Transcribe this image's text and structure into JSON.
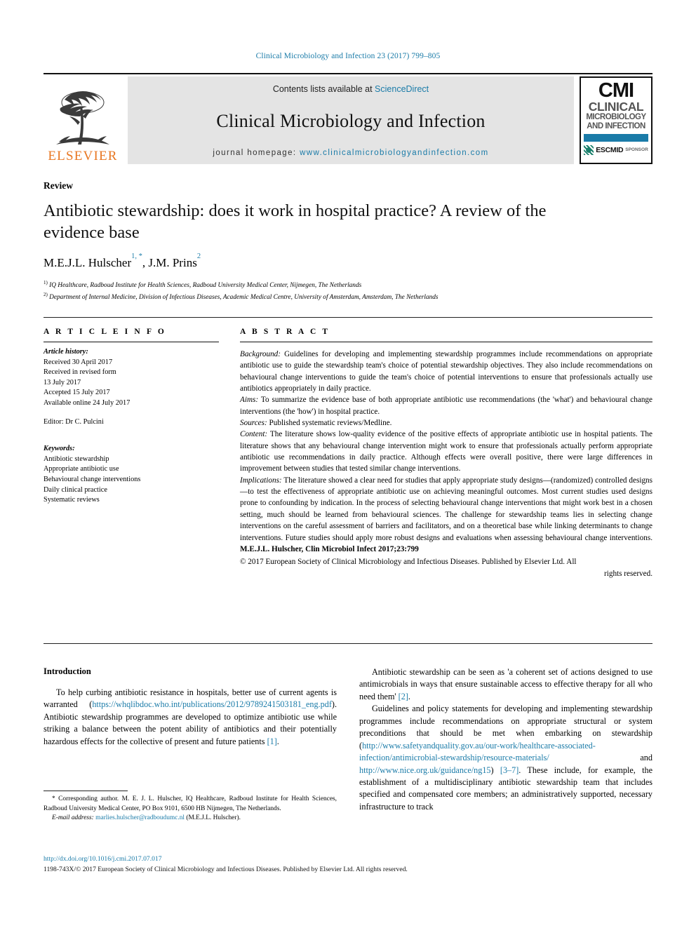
{
  "running_head": "Clinical Microbiology and Infection 23 (2017) 799–805",
  "masthead": {
    "publisher_logo_word": "ELSEVIER",
    "contents_prefix": "Contents lists available at ",
    "contents_link": "ScienceDirect",
    "journal_title": "Clinical Microbiology and Infection",
    "homepage_label": "journal homepage: ",
    "homepage_url": "www.clinicalmicrobiologyandinfection.com",
    "cmi": {
      "abbr": "CMI",
      "line1": "CLINICAL",
      "line2": "MICROBIOLOGY",
      "line3": "AND INFECTION",
      "society": "ESCMID",
      "society_sub": "SPONSOR",
      "bar_color": "#1a7ba8"
    }
  },
  "article": {
    "kind": "Review",
    "title": "Antibiotic stewardship: does it work in hospital practice? A review of the evidence base",
    "authors_plain": "M.E.J.L. Hulscher",
    "authors": [
      {
        "name": "M.E.J.L. Hulscher",
        "marks": "1, *"
      },
      {
        "name": "J.M. Prins",
        "marks": "2"
      }
    ],
    "affiliations": [
      {
        "mark": "1)",
        "text": "IQ Healthcare, Radboud Institute for Health Sciences, Radboud University Medical Center, Nijmegen, The Netherlands"
      },
      {
        "mark": "2)",
        "text": "Department of Internal Medicine, Division of Infectious Diseases, Academic Medical Centre, University of Amsterdam, Amsterdam, The Netherlands"
      }
    ]
  },
  "article_info": {
    "heading": "A R T I C L E  I N F O",
    "history_label": "Article history:",
    "history": [
      "Received 30 April 2017",
      "Received in revised form",
      "13 July 2017",
      "Accepted 15 July 2017",
      "Available online 24 July 2017"
    ],
    "editor": "Editor: Dr C. Pulcini",
    "keywords_label": "Keywords:",
    "keywords": [
      "Antibiotic stewardship",
      "Appropriate antibiotic use",
      "Behavioural change interventions",
      "Daily clinical practice",
      "Systematic reviews"
    ]
  },
  "abstract": {
    "heading": "A B S T R A C T",
    "sections": [
      {
        "label": "Background:",
        "text": " Guidelines for developing and implementing stewardship programmes include recommendations on appropriate antibiotic use to guide the stewardship team's choice of potential stewardship objectives. They also include recommendations on behavioural change interventions to guide the team's choice of potential interventions to ensure that professionals actually use antibiotics appropriately in daily practice."
      },
      {
        "label": "Aims:",
        "text": " To summarize the evidence base of both appropriate antibiotic use recommendations (the 'what') and behavioural change interventions (the 'how') in hospital practice."
      },
      {
        "label": "Sources:",
        "text": " Published systematic reviews/Medline."
      },
      {
        "label": "Content:",
        "text": " The literature shows low-quality evidence of the positive effects of appropriate antibiotic use in hospital patients. The literature shows that any behavioural change intervention might work to ensure that professionals actually perform appropriate antibiotic use recommendations in daily practice. Although effects were overall positive, there were large differences in improvement between studies that tested similar change interventions."
      },
      {
        "label": "Implications:",
        "text": " The literature showed a clear need for studies that apply appropriate study designs—(randomized) controlled designs—to test the effectiveness of appropriate antibiotic use on achieving meaningful outcomes. Most current studies used designs prone to confounding by indication. In the process of selecting behavioural change interventions that might work best in a chosen setting, much should be learned from behavioural sciences. The challenge for stewardship teams lies in selecting change interventions on the careful assessment of barriers and facilitators, and on a theoretical base while linking determinants to change interventions. Future studies should apply more robust designs and evaluations when assessing behavioural change interventions. "
      }
    ],
    "self_citation": "M.E.J.L. Hulscher, Clin Microbiol Infect 2017;23:799",
    "copyright": "© 2017 European Society of Clinical Microbiology and Infectious Diseases. Published by Elsevier Ltd. All",
    "copyright_tail": "rights reserved."
  },
  "body": {
    "section_heading": "Introduction",
    "left_paragraphs": [
      {
        "pre": "To help curbing antibiotic resistance in hospitals, better use of current agents is warranted (",
        "link": "https://whqlibdoc.who.int/publications/2012/9789241503181_eng.pdf",
        "post": "). Antibiotic stewardship programmes are developed to optimize antibiotic use while striking a balance between the potent ability of antibiotics and their potentially hazardous effects for the collective of present and future patients ",
        "ref": "[1]",
        "tail": "."
      }
    ],
    "right_paragraphs": [
      {
        "pre": "Antibiotic stewardship can be seen as 'a coherent set of actions designed to use antimicrobials in ways that ensure sustainable access to effective therapy for all who need them' ",
        "ref": "[2]",
        "tail": ".",
        "indent": false
      },
      {
        "pre": "Guidelines and policy statements for developing and implementing stewardship programmes include recommendations on appropriate structural or system preconditions that should be met when embarking on stewardship (",
        "link": "http://www.safetyandquality.gov.au/our-work/healthcare-associated-infection/antimicrobial-stewardship/resource-materials/",
        "mid": " and ",
        "link2": "http://www.nice.org.uk/guidance/ng15",
        "post": ") ",
        "ref": "[3–7]",
        "tail": ". These include, for example, the establishment of a multidisciplinary antibiotic stewardship team that includes specified and compensated core members; an administratively supported, necessary infrastructure to track",
        "indent": true
      }
    ]
  },
  "footnote": {
    "star": "*",
    "text": " Corresponding author. M. E. J. L. Hulscher, IQ Healthcare, Radboud Institute for Health Sciences, Radboud University Medical Center, PO Box 9101, 6500 HB Nijmegen, The Netherlands.",
    "email_label": "E-mail address: ",
    "email": "marlies.hulscher@radboudumc.nl",
    "email_attrib": " (M.E.J.L. Hulscher)."
  },
  "footer": {
    "doi": "http://dx.doi.org/10.1016/j.cmi.2017.07.017",
    "legal": "1198-743X/© 2017 European Society of Clinical Microbiology and Infectious Diseases. Published by Elsevier Ltd. All rights reserved."
  },
  "colors": {
    "link": "#1a7ba8",
    "elsevier_orange": "#E87722",
    "masthead_gray": "#e4e4e4"
  }
}
